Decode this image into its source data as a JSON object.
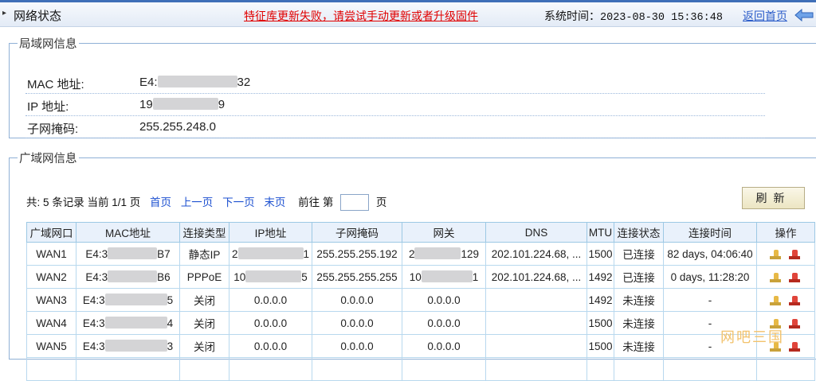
{
  "header": {
    "title": "网络状态",
    "warning": "特征库更新失败，请尝试手动更新或者升级固件",
    "time_label": "系统时间：",
    "time_value": "2023-08-30 15:36:48",
    "back_link": "返回首页"
  },
  "lan": {
    "legend": "局域网信息",
    "rows": [
      {
        "label": "MAC 地址:",
        "value_prefix": "E4:",
        "value_suffix": "32"
      },
      {
        "label": "IP 地址:",
        "value_prefix": "19",
        "value_suffix": "9"
      },
      {
        "label": "子网掩码:",
        "value_prefix": "255.255.248.0",
        "value_suffix": ""
      }
    ]
  },
  "wan": {
    "legend": "广域网信息",
    "pager": {
      "summary": "共: 5 条记录 当前 1/1 页",
      "first": "首页",
      "prev": "上一页",
      "next": "下一页",
      "last": "末页",
      "goto_prefix": "前往 第",
      "goto_suffix": "页"
    },
    "refresh_label": "刷新",
    "columns": [
      "广域网口",
      "MAC地址",
      "连接类型",
      "IP地址",
      "子网掩码",
      "网关",
      "DNS",
      "MTU",
      "连接状态",
      "连接时间",
      "操作"
    ],
    "rows": [
      {
        "port": "WAN1",
        "mac_prefix": "E4:3",
        "mac_suffix": "B7",
        "type": "静态IP",
        "ip_prefix": "2",
        "ip_suffix": "1",
        "mask": "255.255.255.192",
        "gw_prefix": "2",
        "gw_suffix": "129",
        "dns": "202.101.224.68, ...",
        "mtu": "1500",
        "status": "已连接",
        "uptime": "82 days, 04:06:40"
      },
      {
        "port": "WAN2",
        "mac_prefix": "E4:3",
        "mac_suffix": "B6",
        "type": "PPPoE",
        "ip_prefix": "10",
        "ip_suffix": "5",
        "mask": "255.255.255.255",
        "gw_prefix": "10",
        "gw_suffix": "1",
        "dns": "202.101.224.68, ...",
        "mtu": "1492",
        "status": "已连接",
        "uptime": "0 days, 11:28:20"
      },
      {
        "port": "WAN3",
        "mac_prefix": "E4:3",
        "mac_suffix": "5",
        "type": "关闭",
        "ip_prefix": "0.0.0.0",
        "ip_suffix": "",
        "mask": "0.0.0.0",
        "gw_prefix": "0.0.0.0",
        "gw_suffix": "",
        "dns": "",
        "mtu": "1492",
        "status": "未连接",
        "uptime": "-"
      },
      {
        "port": "WAN4",
        "mac_prefix": "E4:3",
        "mac_suffix": "4",
        "type": "关闭",
        "ip_prefix": "0.0.0.0",
        "ip_suffix": "",
        "mask": "0.0.0.0",
        "gw_prefix": "0.0.0.0",
        "gw_suffix": "",
        "dns": "",
        "mtu": "1500",
        "status": "未连接",
        "uptime": "-"
      },
      {
        "port": "WAN5",
        "mac_prefix": "E4:3",
        "mac_suffix": "3",
        "type": "关闭",
        "ip_prefix": "0.0.0.0",
        "ip_suffix": "",
        "mask": "0.0.0.0",
        "gw_prefix": "0.0.0.0",
        "gw_suffix": "",
        "dns": "",
        "mtu": "1500",
        "status": "未连接",
        "uptime": "-"
      }
    ]
  },
  "watermark": "网吧三国"
}
